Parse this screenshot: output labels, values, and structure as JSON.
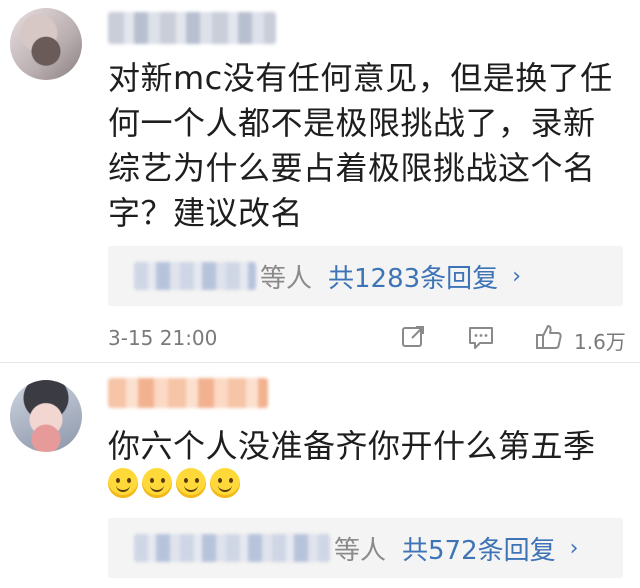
{
  "comments": [
    {
      "text": "对新mc没有任何意见，但是换了任何一个人都不是极限挑战了，录新综艺为什么要占着极限挑战这个名字？建议改名",
      "reply_suffix": "等人",
      "reply_count": "共1283条回复",
      "reply_chevron": "›",
      "time": "3-15 21:00",
      "likes": "1.6万"
    },
    {
      "text": "你六个人没准备齐你开什么第五季",
      "emojis": [
        "smile-emoji",
        "smile-emoji",
        "smile-emoji",
        "smile-emoji"
      ],
      "reply_suffix": "等人",
      "reply_count": "共572条回复",
      "reply_chevron": "›"
    }
  ],
  "icons": {
    "share": "share-icon",
    "comment": "comment-icon",
    "like": "thumbs-up-icon"
  },
  "colors": {
    "link_blue": "#3e74b6",
    "meta_gray": "#7a7a7a",
    "reply_bg": "#f4f4f4"
  }
}
